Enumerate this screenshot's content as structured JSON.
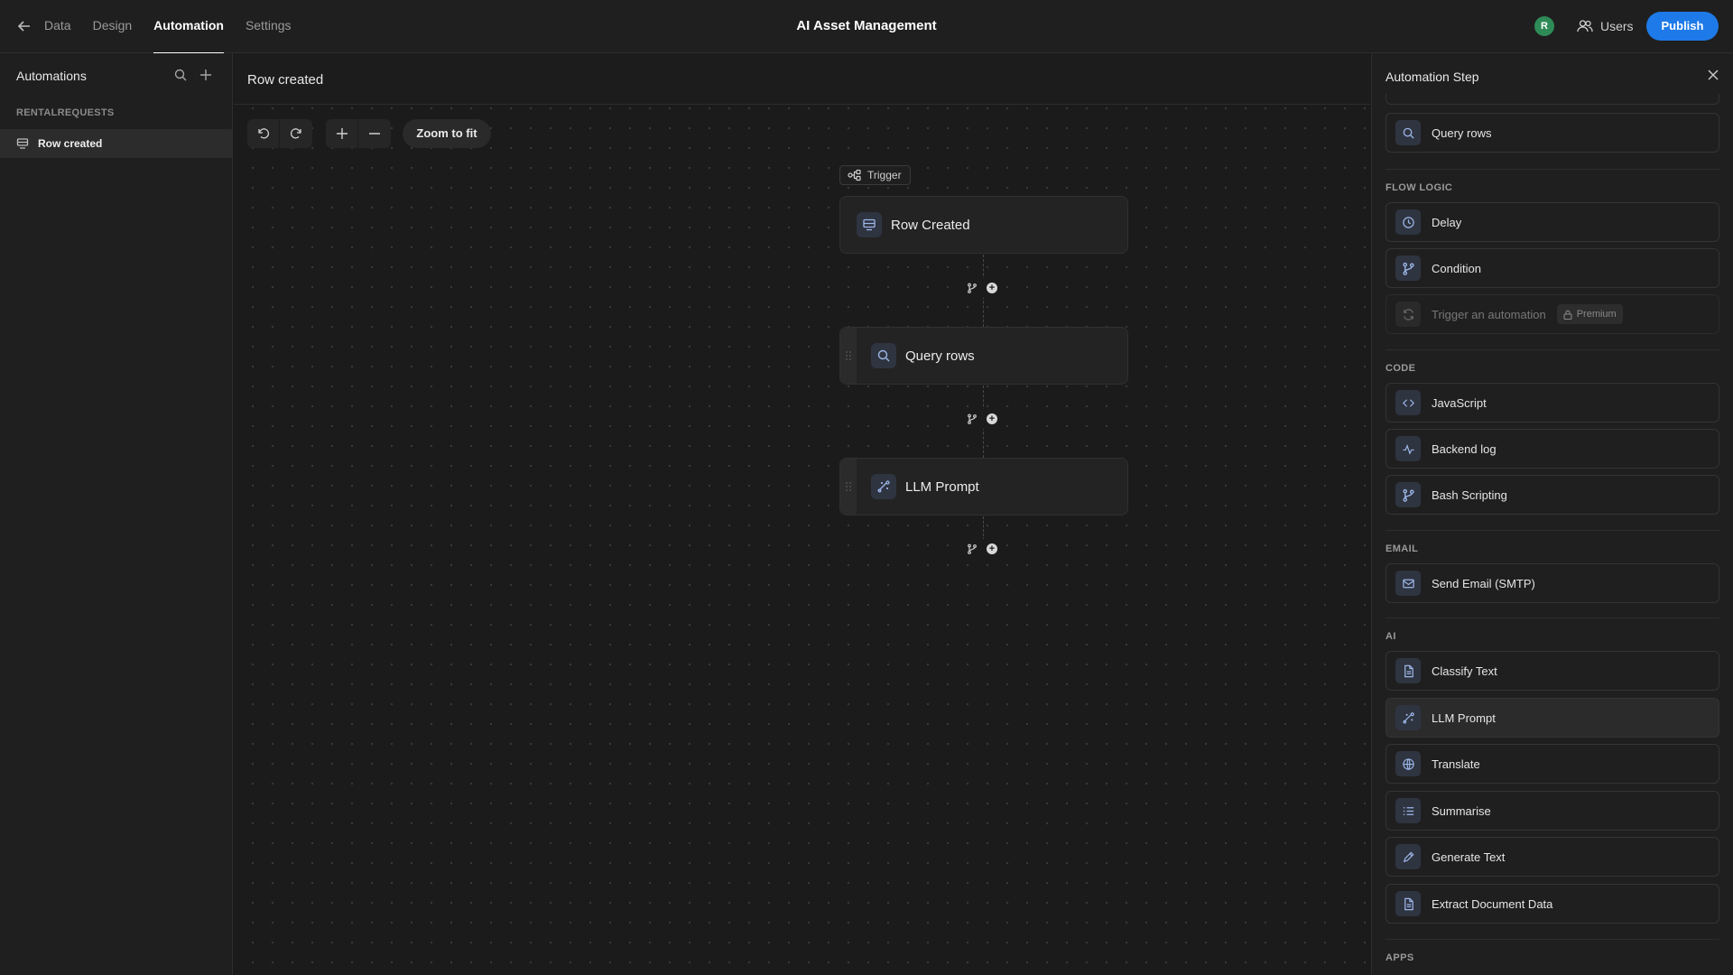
{
  "header": {
    "nav_tabs": [
      "Data",
      "Design",
      "Automation",
      "Settings"
    ],
    "active_tab": "Automation",
    "app_title": "AI Asset Management",
    "avatar_initial": "R",
    "users_label": "Users",
    "publish_label": "Publish",
    "accent_color": "#1e7ae8"
  },
  "sidebar": {
    "title": "Automations",
    "section": "RENTALREQUESTS",
    "items": [
      {
        "label": "Row created",
        "icon": "table-row-icon",
        "selected": true
      }
    ]
  },
  "main": {
    "breadcrumb": "Row created",
    "toolbar": {
      "zoom_to_fit": "Zoom to fit"
    },
    "trigger_tag": "Trigger",
    "nodes": [
      {
        "title": "Row Created",
        "icon": "table-row-icon"
      },
      {
        "title": "Query rows",
        "icon": "search-icon"
      },
      {
        "title": "LLM Prompt",
        "icon": "llm-prompt-icon"
      }
    ]
  },
  "right_panel": {
    "title": "Automation Step",
    "top_item": "Query rows",
    "categories": {
      "flow_logic": "FLOW LOGIC",
      "code": "CODE",
      "email": "EMAIL",
      "ai": "AI",
      "apps": "APPS"
    },
    "flow_logic_items": [
      "Delay",
      "Condition",
      "Trigger an automation"
    ],
    "premium_badge": "Premium",
    "code_items": [
      "JavaScript",
      "Backend log",
      "Bash Scripting"
    ],
    "email_items": [
      "Send Email (SMTP)"
    ],
    "ai_items": [
      "Classify Text",
      "LLM Prompt",
      "Translate",
      "Summarise",
      "Generate Text",
      "Extract Document Data"
    ]
  }
}
